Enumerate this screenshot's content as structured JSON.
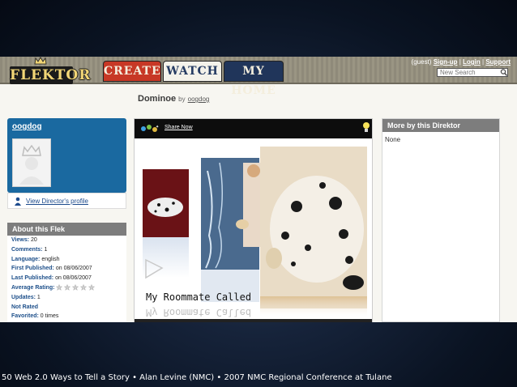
{
  "app": {
    "logo_text": "FLEKTOR",
    "tabs": [
      {
        "label": "CREATE"
      },
      {
        "label": "WATCH"
      },
      {
        "label": "MY HOME"
      }
    ],
    "user_links": {
      "guest": "(guest)",
      "signup": "Sign-up",
      "login": "Login",
      "support": "Support"
    },
    "search_placeholder": "New Search"
  },
  "page": {
    "title": "Dominoe",
    "by": "by",
    "author": "oogdog"
  },
  "profile": {
    "name": "oogdog",
    "link": "View Director's profile"
  },
  "about": {
    "heading": "About this Flek",
    "rows": [
      {
        "key": "Views:",
        "value": "20"
      },
      {
        "key": "Comments:",
        "value": "1"
      },
      {
        "key": "Language:",
        "value": "english"
      },
      {
        "key": "First Published:",
        "value": "on 08/06/2007"
      },
      {
        "key": "Last Published:",
        "value": "on 08/06/2007"
      },
      {
        "key": "Average Rating:",
        "value": ""
      },
      {
        "key": "Updates:",
        "value": "1"
      },
      {
        "key": "Not Rated",
        "value": ""
      },
      {
        "key": "Favorited:",
        "value": "0 times"
      }
    ],
    "rating_stars": 0
  },
  "player": {
    "share_label": "Share Now",
    "caption": "My Roommate Called"
  },
  "more": {
    "heading": "More by this Direktor",
    "empty_text": "None"
  },
  "footer": "50 Web 2.0 Ways to Tell a Story • Alan Levine (NMC) • 2007 NMC Regional Conference at Tulane",
  "colors": {
    "create_tab": "#c73826",
    "watch_tab": "#f4f2ea",
    "myhome_tab": "#20355a",
    "profile_bg": "#1a69a0",
    "box_header": "#7d7d7d"
  }
}
